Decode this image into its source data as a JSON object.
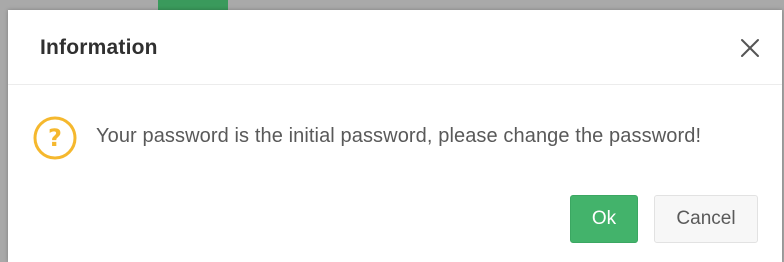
{
  "dialog": {
    "title": "Information",
    "message": "Your password is the initial password, please change the password!",
    "ok_label": "Ok",
    "cancel_label": "Cancel",
    "icons": {
      "close": "close-icon",
      "question": "question-icon"
    }
  },
  "colors": {
    "ok_button": "#43b36b",
    "question_icon": "#f5b82e",
    "backdrop": "#a9a9a9"
  }
}
